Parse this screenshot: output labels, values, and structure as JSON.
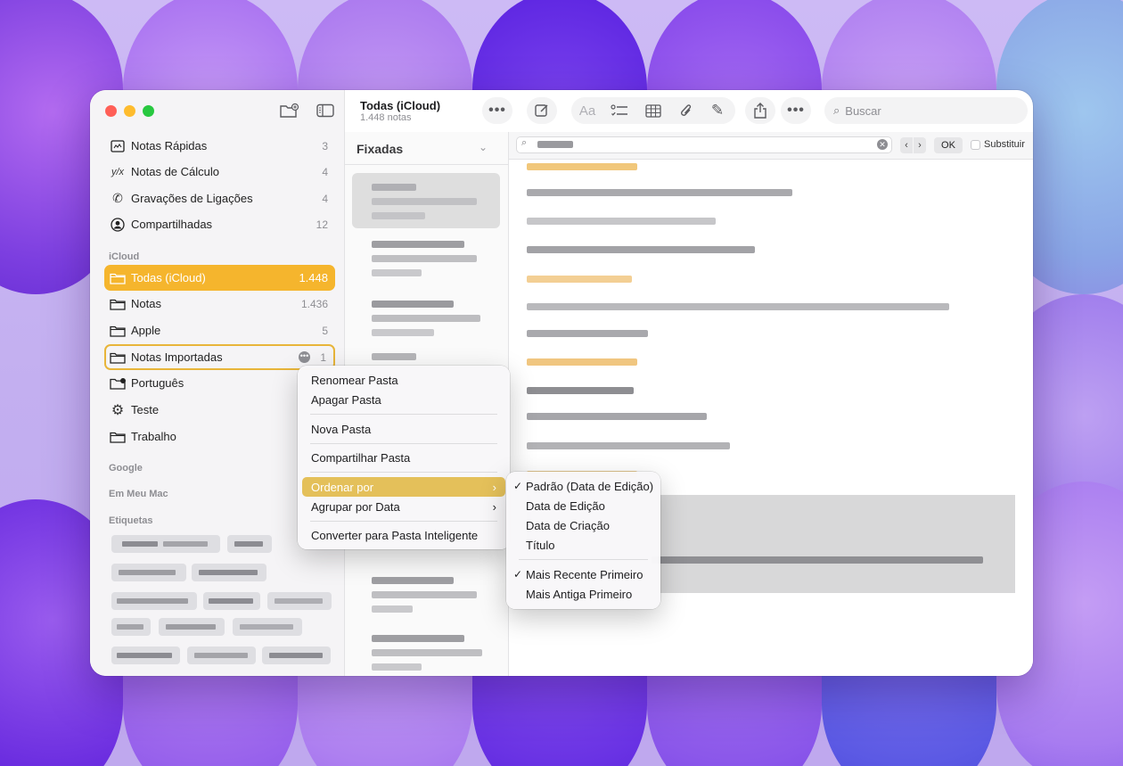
{
  "header": {
    "title": "Todas (iCloud)",
    "subtitle": "1.448 notas",
    "format_label": "Aa",
    "search_placeholder": "Buscar"
  },
  "sidebar": {
    "smart_items": [
      {
        "label": "Notas Rápidas",
        "count": "3"
      },
      {
        "label": "Notas de Cálculo",
        "count": "4"
      },
      {
        "label": "Gravações de Ligações",
        "count": "4"
      },
      {
        "label": "Compartilhadas",
        "count": "12"
      }
    ],
    "icloud_section": "iCloud",
    "folders": [
      {
        "label": "Todas (iCloud)",
        "count": "1.448"
      },
      {
        "label": "Notas",
        "count": "1.436"
      },
      {
        "label": "Apple",
        "count": "5"
      },
      {
        "label": "Notas Importadas",
        "count": "1"
      },
      {
        "label": "Português",
        "count": ""
      },
      {
        "label": "Teste",
        "count": ""
      },
      {
        "label": "Trabalho",
        "count": ""
      }
    ],
    "google_section": "Google",
    "mac_section": "Em Meu Mac",
    "tags_section": "Etiquetas"
  },
  "notelist": {
    "pinned_label": "Fixadas"
  },
  "find_bar": {
    "ok_label": "OK",
    "replace_label": "Substituir"
  },
  "context_menu": {
    "items": [
      "Renomear Pasta",
      "Apagar Pasta",
      "Nova Pasta",
      "Compartilhar Pasta",
      "Ordenar por",
      "Agrupar por Data",
      "Converter para Pasta Inteligente"
    ]
  },
  "sort_submenu": {
    "items": [
      "Padrão (Data de Edição)",
      "Data de Edição",
      "Data de Criação",
      "Título",
      "Mais Recente Primeiro",
      "Mais Antiga Primeiro"
    ],
    "checked": [
      "Padrão (Data de Edição)",
      "Mais Recente Primeiro"
    ]
  },
  "colors": {
    "accent": "#f5b52d",
    "menu_highlight": "#e4c05a",
    "close": "#ff5f57",
    "minimize": "#febc2e",
    "zoom": "#28c840"
  }
}
